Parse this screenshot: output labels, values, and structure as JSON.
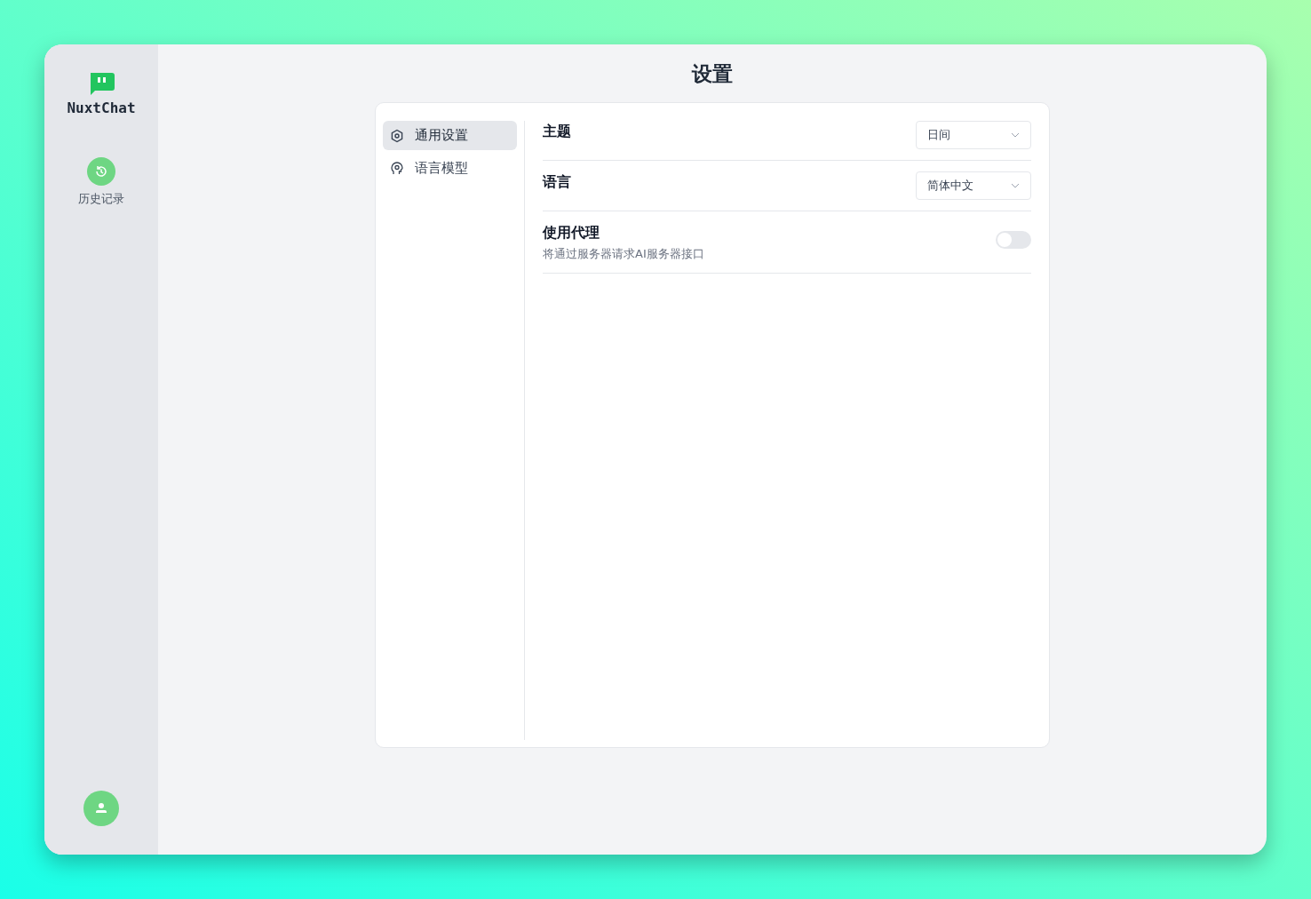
{
  "sidebar": {
    "logo": "NuxtChat",
    "items": [
      {
        "label": "历史记录"
      }
    ]
  },
  "page": {
    "title": "设置"
  },
  "settings_nav": [
    {
      "label": "通用设置",
      "kind": "general",
      "selected": true
    },
    {
      "label": "语言模型",
      "kind": "model",
      "selected": false
    }
  ],
  "settings": [
    {
      "kind": "select",
      "label": "主题",
      "value": "日间"
    },
    {
      "kind": "select",
      "label": "语言",
      "value": "简体中文"
    },
    {
      "kind": "toggle",
      "label": "使用代理",
      "description": "将通过服务器请求AI服务器接口",
      "on": false
    }
  ]
}
